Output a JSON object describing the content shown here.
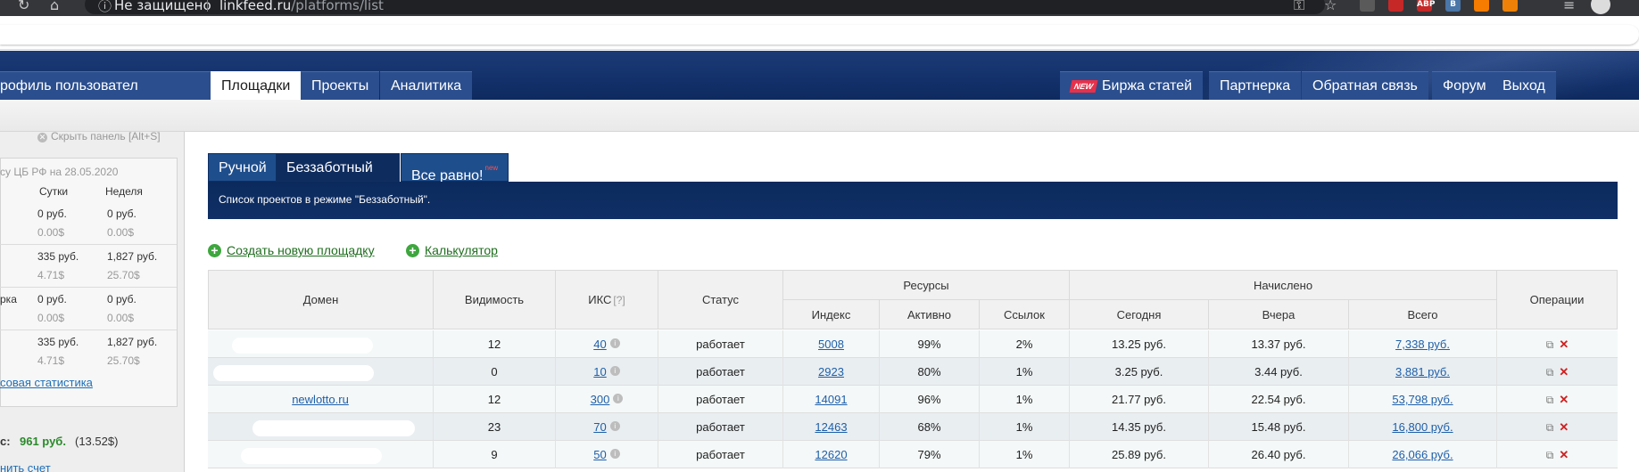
{
  "browser": {
    "secure_label": "Не защищено",
    "url_host": "linkfeed.ru",
    "url_path": "/platforms/list",
    "extensions": [
      {
        "name": "ext-a",
        "color": "#5a5a5a",
        "text": ""
      },
      {
        "name": "ext-b",
        "color": "#c62828",
        "text": ""
      },
      {
        "name": "adblock-icon",
        "color": "#c62828",
        "text": "ABP"
      },
      {
        "name": "vk-icon",
        "color": "#4a76a8",
        "text": "В"
      },
      {
        "name": "rss-icon",
        "color": "#f57c00",
        "text": ""
      },
      {
        "name": "ok-icon",
        "color": "#ee8208",
        "text": ""
      }
    ]
  },
  "nav": {
    "profile": "рофиль пользовател",
    "platforms": "Площадки",
    "projects": "Проекты",
    "analytics": "Аналитика",
    "new_badge": "NEW",
    "articles": "Биржа статей",
    "partner": "Партнерка",
    "feedback": "Обратная связь",
    "forum": "Форум",
    "logout": "Выход"
  },
  "sidebar": {
    "hide_panel": "Скрыть панель [Alt+S]",
    "rate_caption": "су ЦБ РФ на 28.05.2020",
    "col_day": "Сутки",
    "col_week": "Неделя",
    "rows": [
      {
        "label": "",
        "day": "0 руб.",
        "week": "0 руб.",
        "day_usd": "0.00$",
        "week_usd": "0.00$"
      },
      {
        "label": "",
        "day": "335 руб.",
        "week": "1,827 руб.",
        "day_usd": "4.71$",
        "week_usd": "25.70$"
      },
      {
        "label": "рка",
        "day": "0 руб.",
        "week": "0 руб.",
        "day_usd": "0.00$",
        "week_usd": "0.00$"
      },
      {
        "label": "",
        "day": "335 руб.",
        "week": "1,827 руб.",
        "day_usd": "4.71$",
        "week_usd": "25.70$"
      }
    ],
    "stats_link": "совая статистика",
    "balance_label": "с:",
    "balance_value": "961 руб.",
    "balance_usd": "(13.52$)",
    "account_link": "нить счет"
  },
  "tabs": {
    "manual": "Ручной",
    "carefree": "Беззаботный",
    "any": "Все равно!",
    "any_badge": "new"
  },
  "banner_text": "Список проектов в режиме \"Беззаботный\".",
  "actions": {
    "create": "Создать новую площадку",
    "calculator": "Калькулятор"
  },
  "table": {
    "headers": {
      "domain": "Домен",
      "visibility": "Видимость",
      "iks": "ИКС",
      "iks_hint": "[?]",
      "status": "Статус",
      "resources": "Ресурсы",
      "index": "Индекс",
      "active": "Активно",
      "links": "Ссылок",
      "accrued": "Начислено",
      "today": "Сегодня",
      "yesterday": "Вчера",
      "total": "Всего",
      "operations": "Операции"
    },
    "rows": [
      {
        "domain": "",
        "visibility": "12",
        "iks": "40",
        "status": "работает",
        "index": "5008",
        "active": "99%",
        "links": "2%",
        "today": "13.25 руб.",
        "yesterday": "13.37 руб.",
        "total": "7,338 руб."
      },
      {
        "domain": "",
        "visibility": "0",
        "iks": "10",
        "status": "работает",
        "index": "2923",
        "active": "80%",
        "links": "1%",
        "today": "3.25 руб.",
        "yesterday": "3.44 руб.",
        "total": "3,881 руб."
      },
      {
        "domain": "newlotto.ru",
        "visibility": "12",
        "iks": "300",
        "status": "работает",
        "index": "14091",
        "active": "96%",
        "links": "1%",
        "today": "21.77 руб.",
        "yesterday": "22.54 руб.",
        "total": "53,798 руб."
      },
      {
        "domain": "",
        "visibility": "23",
        "iks": "70",
        "status": "работает",
        "index": "12463",
        "active": "68%",
        "links": "1%",
        "today": "14.35 руб.",
        "yesterday": "15.48 руб.",
        "total": "16,800 руб."
      },
      {
        "domain": "",
        "visibility": "9",
        "iks": "50",
        "status": "работает",
        "index": "12620",
        "active": "79%",
        "links": "1%",
        "today": "25.89 руб.",
        "yesterday": "26.40 руб.",
        "total": "26,066 руб."
      }
    ]
  },
  "colors": {
    "header_blue": "#13306a",
    "link_green": "#1f6d1f",
    "link_blue": "#1e5fa8",
    "delete_red": "#d02020"
  }
}
